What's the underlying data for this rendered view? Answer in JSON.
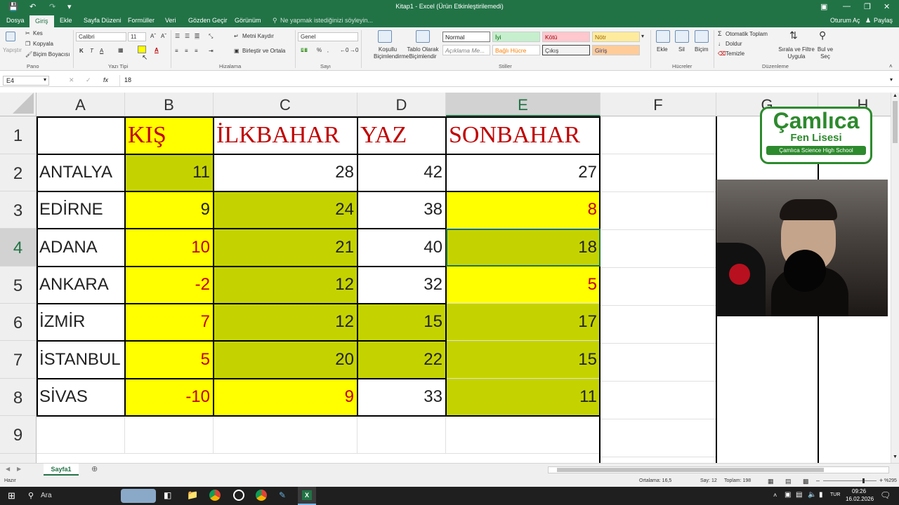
{
  "window": {
    "title": "Kitap1 - Excel (Ürün Etkinleştirilemedi)",
    "signin": "Oturum Aç",
    "share": "Paylaş"
  },
  "tabs": [
    "Dosya",
    "Giriş",
    "Ekle",
    "Sayfa Düzeni",
    "Formüller",
    "Veri",
    "Gözden Geçir",
    "Görünüm"
  ],
  "tellme": "Ne yapmak istediğinizi söyleyin...",
  "ribbon": {
    "clipboard": {
      "paste": "Yapıştır",
      "cut": "Kes",
      "copy": "Kopyala",
      "painter": "Biçim Boyacısı",
      "group": "Pano"
    },
    "font": {
      "name": "Calibri",
      "size": "11",
      "group": "Yazı Tipi",
      "bold": "K",
      "italic": "T",
      "underline": "A"
    },
    "alignment": {
      "wrap": "Metni Kaydır",
      "merge": "Birleştir ve Ortala",
      "group": "Hizalama"
    },
    "number": {
      "format": "Genel",
      "group": "Sayı"
    },
    "styles": {
      "cond": "Koşullu Biçimlendirme",
      "table": "Tablo Olarak Biçimlendir",
      "group": "Stiller",
      "normal": "Normal",
      "iyi": "İyi",
      "kotu": "Kötü",
      "notr": "Nötr",
      "aciklama": "Açıklama Me...",
      "bagli": "Bağlı Hücre",
      "cikis": "Çıkış",
      "giris": "Giriş"
    },
    "cells": {
      "insert": "Ekle",
      "delete": "Sil",
      "format": "Biçim",
      "group": "Hücreler"
    },
    "editing": {
      "autosum": "Otomatik Toplam",
      "fill": "Doldur",
      "clear": "Temizle",
      "sort": "Sırala ve Filtre Uygula",
      "find": "Bul ve Seç",
      "group": "Düzenleme"
    }
  },
  "formula": {
    "namebox": "E4",
    "fx": "fx",
    "value": "18"
  },
  "columns": [
    "A",
    "B",
    "C",
    "D",
    "E",
    "F",
    "G",
    "H"
  ],
  "rows": [
    "1",
    "2",
    "3",
    "4",
    "5",
    "6",
    "7",
    "8",
    "9"
  ],
  "table": {
    "headers": [
      "KIŞ",
      "İLKBAHAR",
      "YAZ",
      "SONBAHAR"
    ],
    "cities": [
      "ANTALYA",
      "EDİRNE",
      "ADANA",
      "ANKARA",
      "İZMİR",
      "İSTANBUL",
      "SİVAS"
    ],
    "values": [
      [
        "11",
        "28",
        "42",
        "27"
      ],
      [
        "9",
        "24",
        "38",
        "8"
      ],
      [
        "10",
        "21",
        "40",
        "18"
      ],
      [
        "-2",
        "12",
        "32",
        "5"
      ],
      [
        "7",
        "12",
        "15",
        "17"
      ],
      [
        "5",
        "20",
        "22",
        "15"
      ],
      [
        "-10",
        "9",
        "33",
        "11"
      ]
    ]
  },
  "colors": {
    "yellow": "#ffff00",
    "olive": "#c4d300",
    "red": "#c00000",
    "excel_green": "#217346"
  },
  "logo": {
    "line1": "Çamlıca",
    "line2": "Fen Lisesi",
    "line3": "Çamlıca Science High School"
  },
  "sheet": {
    "tab": "Sayfa1"
  },
  "status": {
    "ready": "Hazır",
    "average": "Ortalama: 16,5",
    "count": "Say: 12",
    "sum": "Toplam: 198",
    "zoom": "%295"
  },
  "taskbar": {
    "search": "Ara",
    "lang": "TUR",
    "time": "09:26",
    "date": "16.02.2026"
  }
}
